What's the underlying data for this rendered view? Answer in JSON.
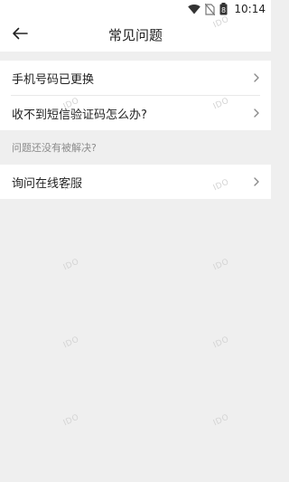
{
  "status_bar": {
    "time": "10:14",
    "battery_label": "8"
  },
  "app_bar": {
    "title": "常见问题"
  },
  "faq": {
    "items": [
      {
        "label": "手机号码已更换"
      },
      {
        "label": "收不到短信验证码怎么办?"
      }
    ]
  },
  "section_hint": "问题还没有被解决?",
  "contact": {
    "items": [
      {
        "label": "询问在线客服"
      }
    ]
  },
  "watermark_text": "IDO",
  "colors": {
    "background": "#efefef",
    "card": "#ffffff",
    "text": "#222222",
    "hint_text": "#8c8c8c",
    "chevron": "#8a8a8a"
  }
}
